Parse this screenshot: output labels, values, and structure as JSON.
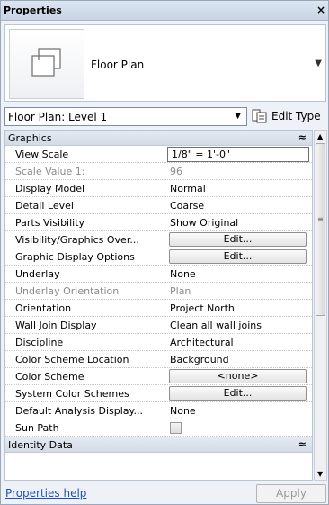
{
  "panel": {
    "title": "Properties",
    "close_glyph": "×"
  },
  "type_selector": {
    "name": "Floor Plan",
    "icon": "floor-plan-icon",
    "arrow": "▼"
  },
  "instance_filter": {
    "value": "Floor Plan: Level 1",
    "arrow": "▼"
  },
  "edit_type": {
    "label": "Edit Type",
    "icon": "edit-type-icon"
  },
  "groups": [
    {
      "label": "Graphics",
      "collapse_glyph": "≈"
    },
    {
      "label": "Identity Data",
      "collapse_glyph": "≈"
    }
  ],
  "properties": [
    {
      "name": "View Scale",
      "value": "1/8\" = 1'-0\""
    },
    {
      "name": "Scale Value    1:",
      "value": "96"
    },
    {
      "name": "Display Model",
      "value": "Normal"
    },
    {
      "name": "Detail Level",
      "value": "Coarse"
    },
    {
      "name": "Parts Visibility",
      "value": "Show Original"
    },
    {
      "name": "Visibility/Graphics Over...",
      "value": "Edit..."
    },
    {
      "name": "Graphic Display Options",
      "value": "Edit..."
    },
    {
      "name": "Underlay",
      "value": "None"
    },
    {
      "name": "Underlay Orientation",
      "value": "Plan"
    },
    {
      "name": "Orientation",
      "value": "Project North"
    },
    {
      "name": "Wall Join Display",
      "value": "Clean all wall joins"
    },
    {
      "name": "Discipline",
      "value": "Architectural"
    },
    {
      "name": "Color Scheme Location",
      "value": "Background"
    },
    {
      "name": "Color Scheme",
      "value": "<none>"
    },
    {
      "name": "System Color Schemes",
      "value": "Edit..."
    },
    {
      "name": "Default Analysis Display...",
      "value": "None"
    },
    {
      "name": "Sun Path",
      "value": ""
    }
  ],
  "footer": {
    "help_label": "Properties help",
    "apply_label": "Apply"
  },
  "colors": {
    "link": "#1a52b8",
    "header": "#d3dbe6"
  }
}
